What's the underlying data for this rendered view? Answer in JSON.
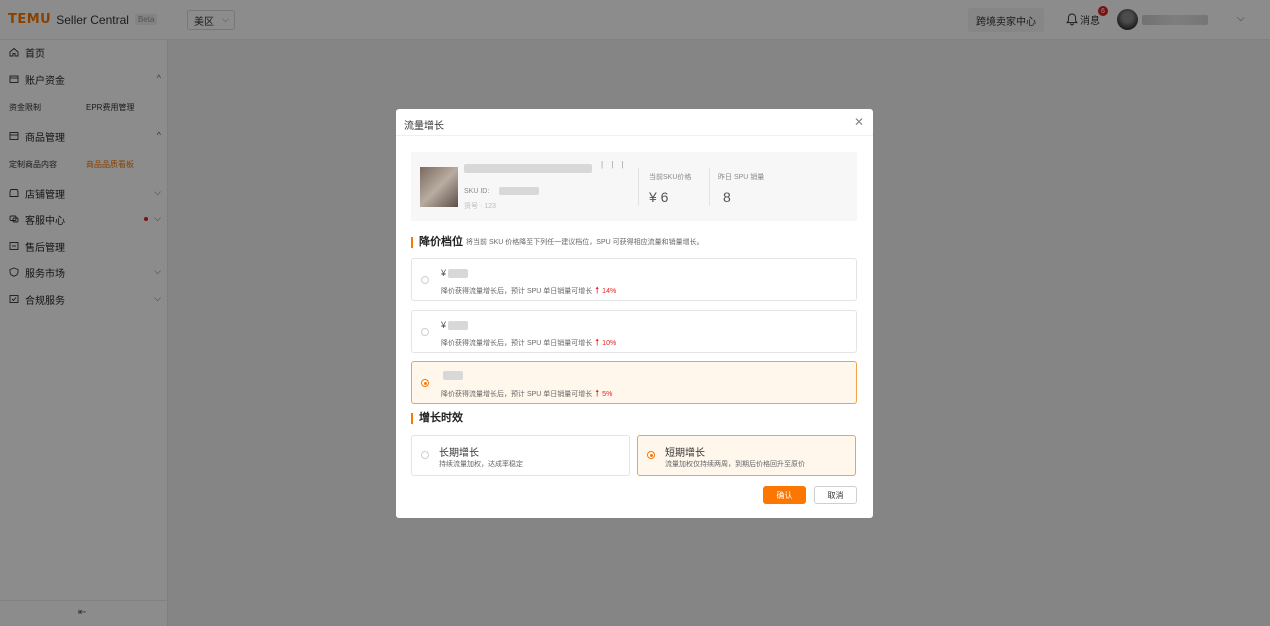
{
  "header": {
    "brand": "TEMU",
    "product": "Seller Central",
    "beta": "Beta",
    "region": "美区",
    "cross_border_btn": "跨境卖家中心",
    "messages_label": "消息",
    "messages_badge": "6"
  },
  "sidebar": {
    "items": [
      {
        "label": "首页",
        "icon": "home-icon"
      },
      {
        "label": "账户资金",
        "icon": "wallet-icon"
      },
      {
        "label": "商品管理",
        "icon": "goods-icon"
      },
      {
        "label": "店铺管理",
        "icon": "store-icon"
      },
      {
        "label": "客服中心",
        "icon": "service-icon"
      },
      {
        "label": "售后管理",
        "icon": "after-sales-icon"
      },
      {
        "label": "服务市场",
        "icon": "market-icon"
      },
      {
        "label": "合规服务",
        "icon": "compliance-icon"
      }
    ],
    "sub_account": [
      "资金限制",
      "EPR费用管理"
    ],
    "sub_goods": [
      "定制商品内容",
      "商品品质看板"
    ]
  },
  "modal": {
    "title": "流量增长",
    "product": {
      "ticks": "| | |",
      "sku_label": "SKU ID:",
      "line3": "货号 · 123",
      "current_price_label": "当前SKU价格",
      "current_price_value": "¥  6",
      "yesterday_sales_label": "昨日 SPU 销量",
      "yesterday_sales_value": "8"
    },
    "price_section": {
      "title": "降价档位",
      "desc": "将当前 SKU 价格降至下列任一建议档位，SPU 可获得相应流量和销量增长。",
      "options": [
        {
          "prefix": "¥",
          "desc": "降价获得流量增长后，预计 SPU 单日销量可增长",
          "pct": "14%",
          "selected": false
        },
        {
          "prefix": "¥",
          "desc": "降价获得流量增长后，预计 SPU 单日销量可增长",
          "pct": "10%",
          "selected": false
        },
        {
          "prefix": "",
          "desc": "降价获得流量增长后，预计 SPU 单日销量可增长",
          "pct": "5%",
          "selected": true
        }
      ]
    },
    "growth_section": {
      "title": "增长时效",
      "long": {
        "title": "长期增长",
        "desc": "持续流量加权，达成率稳定"
      },
      "short": {
        "title": "短期增长",
        "desc": "流量加权仅持续两周，到期后价格回升至原价"
      }
    },
    "confirm": "确认",
    "cancel": "取消"
  },
  "colors": {
    "accent": "#fb7701",
    "up": "#e02020"
  }
}
